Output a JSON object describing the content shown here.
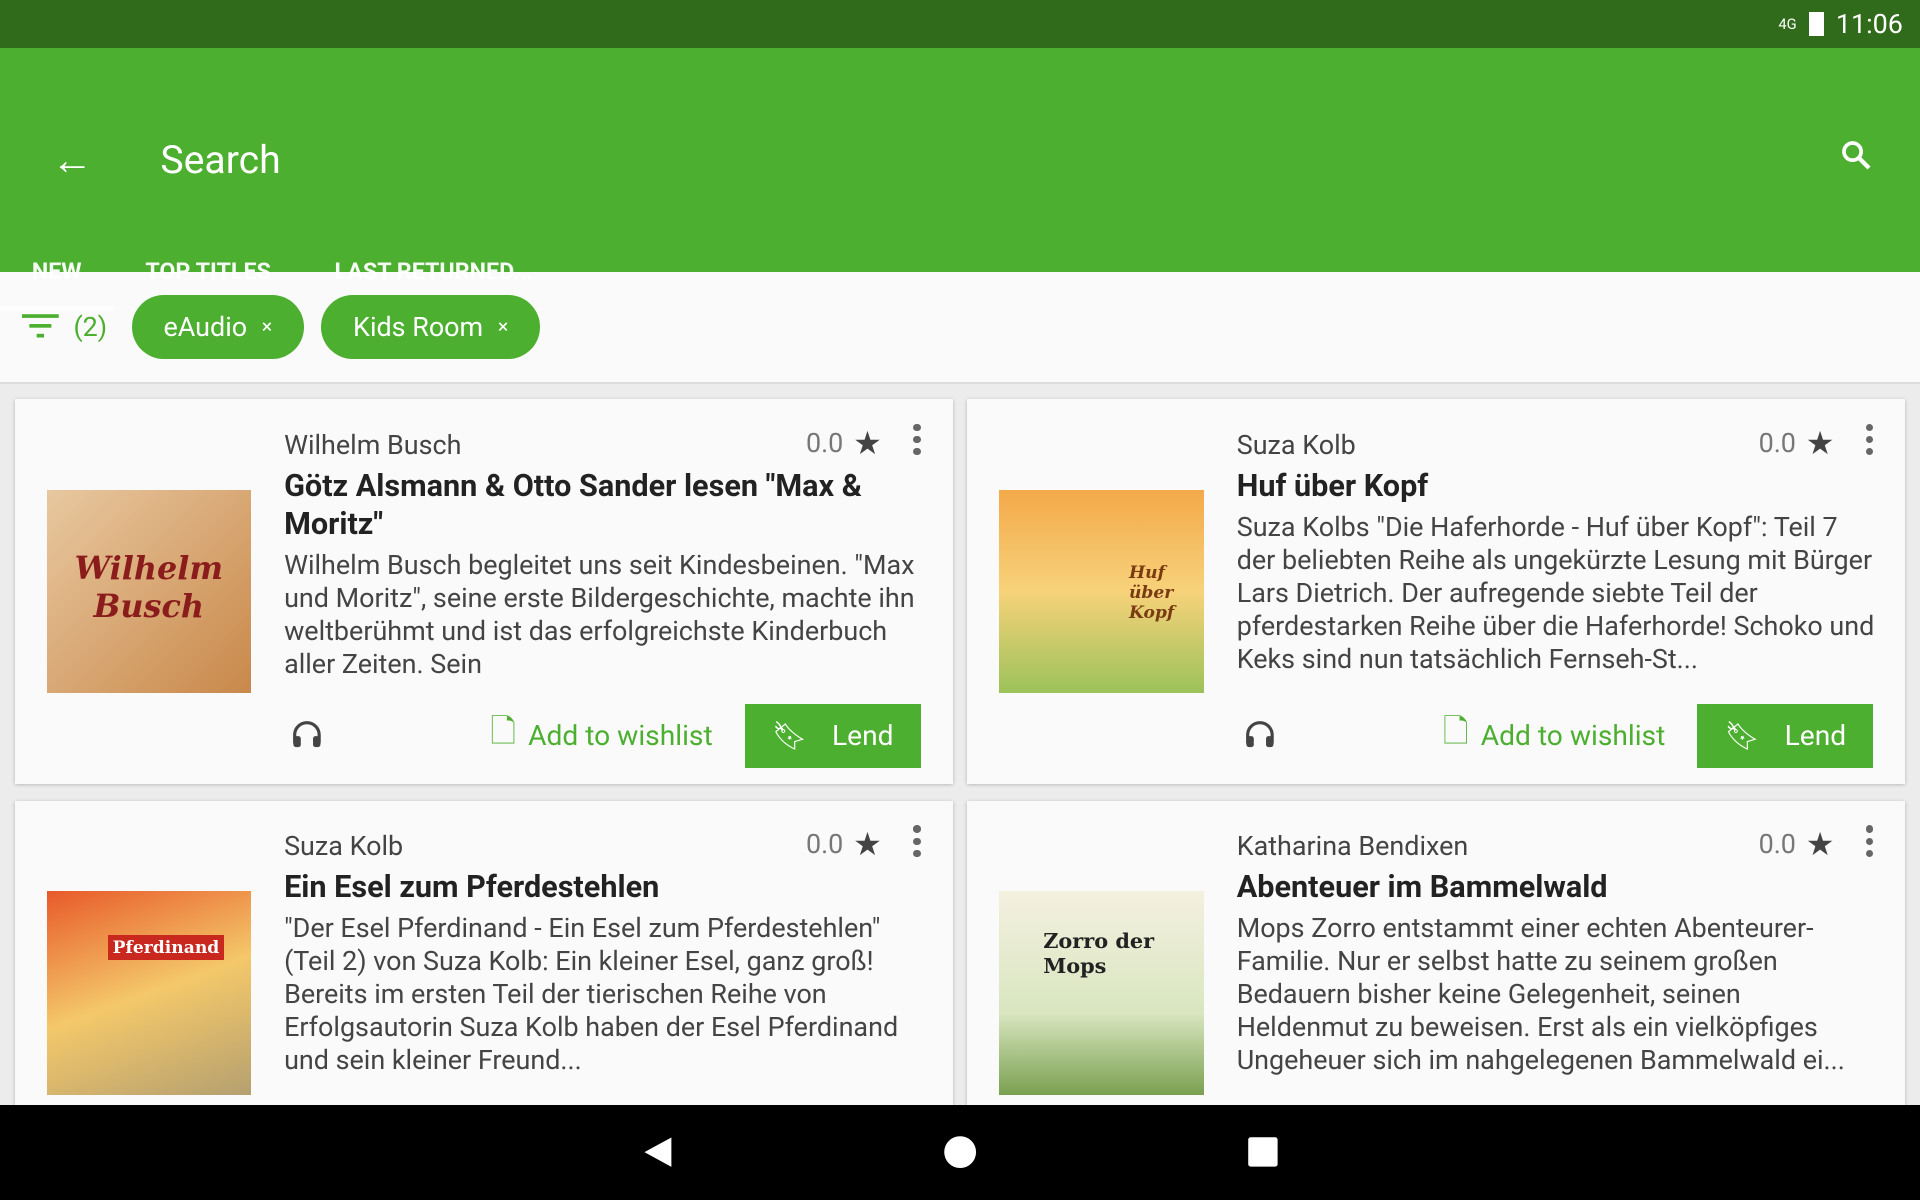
{
  "status": {
    "network": "4G",
    "time": "11:06"
  },
  "appbar": {
    "title": "Search"
  },
  "tabs": [
    {
      "label": "NEW",
      "active": true
    },
    {
      "label": "TOP TITLES"
    },
    {
      "label": "LAST RETURNED..."
    }
  ],
  "filters": {
    "count": "(2)",
    "chips": [
      {
        "label": "eAudio"
      },
      {
        "label": "Kids Room"
      }
    ],
    "remove": "×"
  },
  "accent": "#4caf2f",
  "cards": [
    {
      "author": "Wilhelm Busch",
      "rating": "0.0",
      "title": "Götz Alsmann & Otto Sander lesen \"Max & Moritz\"",
      "desc": "Wilhelm Busch begleitet uns seit Kindesbeinen. \"Max und Moritz\", seine erste Bildergeschichte, machte ihn weltberühmt und ist das erfolgreichste Kinderbuch aller Zeiten. Sein",
      "wishlist": "Add to wishlist",
      "lend": "Lend",
      "cover_text": "Wilhelm Busch"
    },
    {
      "author": "Suza Kolb",
      "rating": "0.0",
      "title": "Huf über Kopf",
      "desc": "Suza Kolbs \"Die Haferhorde - Huf über Kopf\": Teil 7 der beliebten Reihe als ungekürzte Lesung mit Bürger Lars Dietrich. Der aufregende siebte Teil der pferdestarken Reihe über die Haferhorde! Schoko und Keks sind nun tatsächlich Fernseh-St...",
      "wishlist": "Add to wishlist",
      "lend": "Lend",
      "cover_text": "Huf über Kopf"
    },
    {
      "author": "Suza Kolb",
      "rating": "0.0",
      "title": "Ein Esel zum Pferdestehlen",
      "desc": "\"Der Esel Pferdinand - Ein Esel zum Pferdestehlen\" (Teil 2) von Suza Kolb: Ein kleiner Esel, ganz groß! Bereits im ersten Teil der tierischen Reihe von Erfolgsautorin Suza Kolb haben der Esel Pferdinand und sein kleiner Freund...",
      "cover_text": "Pferdinand"
    },
    {
      "author": "Katharina Bendixen",
      "rating": "0.0",
      "title": "Abenteuer im Bammelwald",
      "desc": "Mops Zorro entstammt einer echten Abenteurer-Familie. Nur er selbst hatte zu seinem großen Bedauern bisher keine Gelegenheit, seinen Heldenmut zu beweisen. Erst als ein vielköpfiges Ungeheuer sich im nahgelegenen Bammelwald ei...",
      "cover_text": "Zorro der Mops"
    }
  ]
}
